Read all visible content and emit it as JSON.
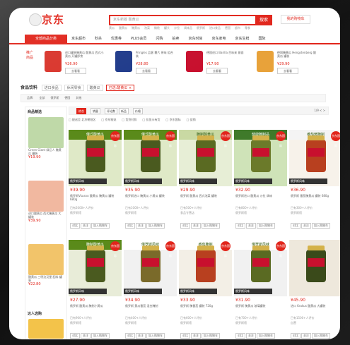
{
  "header": {
    "logo_text": "京东",
    "search_placeholder": "京东新版 酸黄瓜",
    "search_button": "搜索",
    "cart_label": "我的购物车",
    "hotwords": [
      "黄瓜",
      "酸黄瓜",
      "腌黄瓜",
      "泡菜",
      "橄榄",
      "罐头",
      "沙拉",
      "调味品",
      "俄罗斯",
      "进口食品",
      "德国",
      "超市",
      "零食"
    ]
  },
  "nav": {
    "category_label": "全部商品分类",
    "items": [
      "京东超市",
      "秒杀",
      "优惠券",
      "PLUS会员",
      "闪购",
      "拍卖",
      "京东时尚",
      "京东家电",
      "京东生鲜",
      "国际"
    ]
  },
  "promo": {
    "label": "推广商品",
    "items": [
      {
        "title": "进口罐装腌黄瓜 酸黄瓜 西式小黄瓜 开罐即食",
        "price": "¥26.90",
        "button": "去看看"
      },
      {
        "title": "Pringles 品客 薯片 原味 组合装",
        "price": "¥28.80",
        "button": "去看看"
      },
      {
        "title": "德国进口 Barilla 百味来 意面",
        "price": "¥17.90",
        "button": "去看看"
      },
      {
        "title": "德国腌黄瓜 Hengstenberg 酸黄瓜 罐装",
        "price": "¥29.90",
        "button": "去看看"
      }
    ]
  },
  "breadcrumb": {
    "title": "食品饮料",
    "chips": [
      "进口食品",
      "休闲零食",
      "酸黄瓜"
    ],
    "filter_chip": "已选:酸黄瓜 ×"
  },
  "brand_row": {
    "label": "品牌:",
    "items": [
      "全部",
      "俄罗斯",
      "德国",
      "其他"
    ]
  },
  "sidebar": {
    "title": "商品精选",
    "items": [
      {
        "text": "Green Giant 绿巨人 腌黄瓜 罐装",
        "price": "¥19.90"
      },
      {
        "text": "进口酸黄瓜 西式腌黄瓜 大罐装",
        "price": "¥39.90"
      },
      {
        "text": "酸黄瓜 三明治汉堡 配料 罐装",
        "price": "¥22.80"
      }
    ],
    "title2": "达人选购"
  },
  "filterbar": {
    "items": [
      "综合",
      "销量",
      "评论数",
      "新品",
      "价格"
    ],
    "page": "1/9 < >",
    "row2": [
      "配送至 北京朝阳区",
      "京东物流",
      "货到付款",
      "仅显示有货",
      "京东国际",
      "促销"
    ]
  },
  "products": [
    {
      "banner": "俄式酸黄瓜",
      "badge": "京东国际",
      "strip": "俄罗斯风味",
      "price": "¥39.90",
      "title": "俄罗斯Vkusno 酸黄瓜 腌黄瓜 罐装 680g",
      "meta": "已有2000+人评价",
      "store": "俄罗斯馆",
      "actions": [
        "对比",
        "关注",
        "加入购物车"
      ]
    },
    {
      "banner": "俄式酸黄瓜",
      "badge": "京东国际",
      "strip": "俄罗斯风味",
      "price": "¥35.90",
      "title": "俄罗斯进口 腌黄瓜 小黄瓜 罐装",
      "meta": "已有1000+人评价",
      "store": "俄罗斯馆",
      "actions": [
        "对比",
        "关注",
        "加入购物车"
      ]
    },
    {
      "banner": "腌制酸黄瓜",
      "badge": "京东国际",
      "strip": "俄罗斯风味",
      "price": "¥29.90",
      "title": "俄罗斯 酸黄瓜 西式泡菜 罐装",
      "meta": "已有500+人评价",
      "store": "食品专营店",
      "actions": [
        "对比",
        "关注",
        "加入购物车"
      ]
    },
    {
      "banner": "健康腌制品",
      "badge": "京东国际",
      "strip": "俄罗斯风味",
      "price": "¥32.90",
      "title": "俄罗斯进口 酸黄瓜 沙拉 调味",
      "meta": "已有800+人评价",
      "store": "俄罗斯馆",
      "actions": [
        "对比",
        "关注",
        "加入购物车"
      ]
    },
    {
      "banner": "番茄酱腌制",
      "badge": "京东国际",
      "strip": "俄罗斯风味",
      "price": "¥36.90",
      "title": "俄罗斯 番茄腌黄瓜 罐装 680g",
      "meta": "已有300+人评价",
      "store": "俄罗斯馆",
      "actions": [
        "对比",
        "关注",
        "加入购物车"
      ]
    },
    {
      "banner": "腌制酸黄瓜",
      "badge": "京东国际",
      "strip": "俄罗斯风味",
      "price": "¥27.90",
      "title": "俄罗斯 酸黄瓜 腌制小黄瓜",
      "meta": "已有900+人评价",
      "store": "俄罗斯馆",
      "actions": [
        "对比",
        "关注",
        "加入购物车"
      ]
    },
    {
      "banner": "俄罗斯风味",
      "badge": "京东国际",
      "strip": "俄罗斯风味",
      "price": "¥34.90",
      "title": "俄罗斯 黄瓜番茄 混合腌制",
      "meta": "已有400+人评价",
      "store": "俄罗斯馆",
      "actions": [
        "对比",
        "关注",
        "加入购物车"
      ]
    },
    {
      "banner": "番茄腌制",
      "badge": "京东国际",
      "strip": "俄罗斯风味",
      "price": "¥33.90",
      "title": "俄罗斯 腌番茄 罐装 720g",
      "meta": "已有600+人评价",
      "store": "俄罗斯馆",
      "actions": [
        "对比",
        "关注",
        "加入购物车"
      ]
    },
    {
      "banner": "俄罗斯风味",
      "badge": "京东国际",
      "strip": "俄罗斯风味",
      "price": "¥31.90",
      "title": "俄罗斯 腌黄瓜 玻璃罐装",
      "meta": "已有700+人评价",
      "store": "俄罗斯馆",
      "actions": [
        "对比",
        "关注",
        "加入购物车"
      ]
    },
    {
      "banner": "",
      "badge": "",
      "strip": "",
      "price": "¥45.90",
      "title": "进口 Krakus 酸黄瓜 大罐装",
      "meta": "已有1500+人评价",
      "store": "自营",
      "actions": [
        "对比",
        "关注",
        "加入购物车"
      ]
    }
  ],
  "colors": {
    "brand": "#e1251b"
  }
}
